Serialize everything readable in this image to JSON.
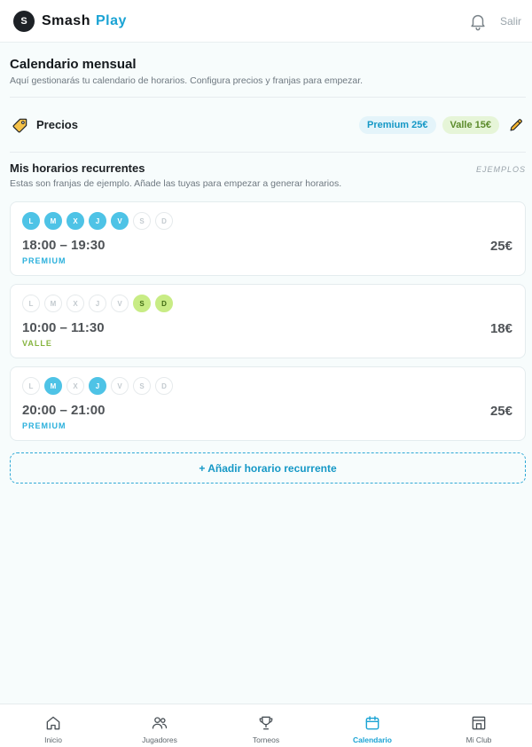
{
  "header": {
    "logo_initial": "S",
    "brand_part1": "Smash",
    "brand_part2": "Play",
    "logout_label": "Salir"
  },
  "calendar": {
    "title": "Calendario mensual",
    "subtitle": "Aquí gestionarás tu calendario de horarios. Configura precios y franjas para empezar."
  },
  "prices": {
    "label": "Precios",
    "premium_chip": "Premium 25€",
    "valle_chip": "Valle 15€"
  },
  "recurring": {
    "title": "Mis horarios recurrentes",
    "examples_badge": "EJEMPLOS",
    "subtitle": "Estas son franjas de ejemplo. Añade las tuyas para empezar a generar horarios.",
    "slots": [
      {
        "days": [
          {
            "letter": "L",
            "active": true
          },
          {
            "letter": "M",
            "active": true
          },
          {
            "letter": "X",
            "active": true
          },
          {
            "letter": "J",
            "active": true
          },
          {
            "letter": "V",
            "active": true
          },
          {
            "letter": "S",
            "active": false
          },
          {
            "letter": "D",
            "active": false
          }
        ],
        "time": "18:00 – 19:30",
        "kind": "PREMIUM",
        "kind_type": "premium",
        "price": "25€"
      },
      {
        "days": [
          {
            "letter": "L",
            "active": false
          },
          {
            "letter": "M",
            "active": false
          },
          {
            "letter": "X",
            "active": false
          },
          {
            "letter": "J",
            "active": false
          },
          {
            "letter": "V",
            "active": false
          },
          {
            "letter": "S",
            "active": true
          },
          {
            "letter": "D",
            "active": true
          }
        ],
        "time": "10:00 – 11:30",
        "kind": "VALLE",
        "kind_type": "valle",
        "price": "18€"
      },
      {
        "days": [
          {
            "letter": "L",
            "active": false
          },
          {
            "letter": "M",
            "active": true
          },
          {
            "letter": "X",
            "active": false
          },
          {
            "letter": "J",
            "active": true
          },
          {
            "letter": "V",
            "active": false
          },
          {
            "letter": "S",
            "active": false
          },
          {
            "letter": "D",
            "active": false
          }
        ],
        "time": "20:00 – 21:00",
        "kind": "PREMIUM",
        "kind_type": "premium",
        "price": "25€"
      }
    ],
    "add_button": "+ Añadir horario recurrente"
  },
  "tabs": [
    {
      "label": "Inicio",
      "icon": "home-icon",
      "active": false
    },
    {
      "label": "Jugadores",
      "icon": "users-icon",
      "active": false
    },
    {
      "label": "Torneos",
      "icon": "trophy-icon",
      "active": false
    },
    {
      "label": "Calendario",
      "icon": "calendar-icon",
      "active": true
    },
    {
      "label": "Mi Club",
      "icon": "club-icon",
      "active": false
    }
  ],
  "colors": {
    "accent": "#1aa3d4",
    "premium": "#4ec3e6",
    "valle": "#c8ec85"
  }
}
